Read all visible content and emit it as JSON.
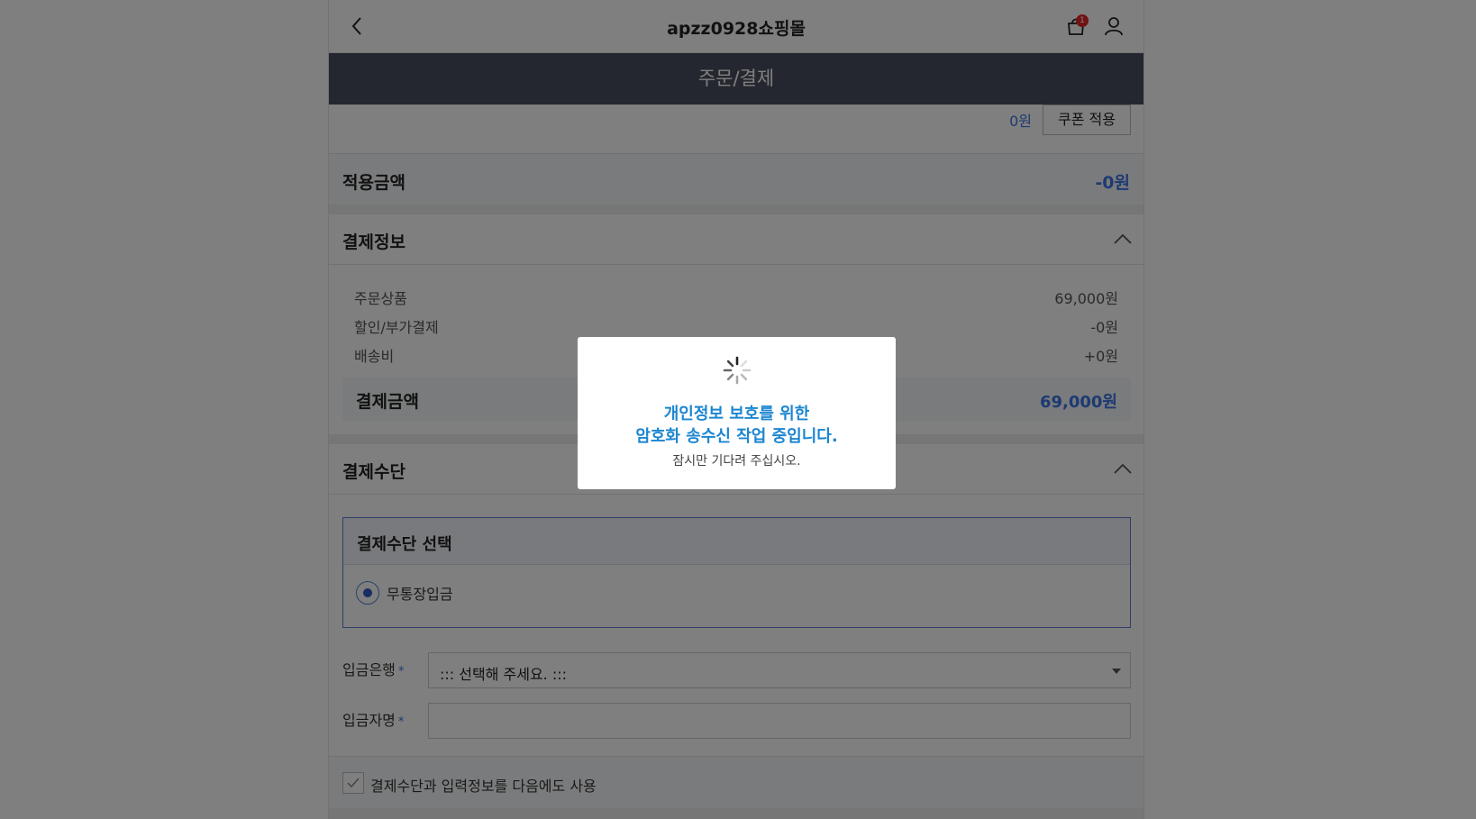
{
  "header": {
    "mall_name": "apzz0928쇼핑몰",
    "cart_count": "1"
  },
  "page_title": "주문/결제",
  "coupon": {
    "amount": "0원",
    "apply_button": "쿠폰 적용"
  },
  "applied": {
    "label": "적용금액",
    "value": "-0원"
  },
  "payment_info": {
    "title": "결제정보",
    "rows": [
      {
        "label": "주문상품",
        "value": "69,000원"
      },
      {
        "label": "할인/부가결제",
        "value": "-0원"
      },
      {
        "label": "배송비",
        "value": "+0원"
      }
    ],
    "total_label": "결제금액",
    "total_value": "69,000원"
  },
  "payment_method": {
    "title": "결제수단",
    "box_title": "결제수단 선택",
    "selected_option": "무통장입금",
    "bank_label": "입금은행",
    "required_mark": "*",
    "bank_select_value": "::: 선택해 주세요. :::",
    "depositor_label": "입금자명",
    "depositor_value": "",
    "save_checkbox_label": "결제수단과 입력정보를 다음에도 사용"
  },
  "modal": {
    "line1": "개인정보 보호를 위한",
    "line2": "암호화 송수신 작업 중입니다.",
    "sub": "잠시만 기다려 주십시오."
  },
  "colors": {
    "accent_blue": "#3a74e6",
    "header_dark": "#4a4f61",
    "modal_text": "#1c86d0",
    "badge_red": "#e22626"
  }
}
